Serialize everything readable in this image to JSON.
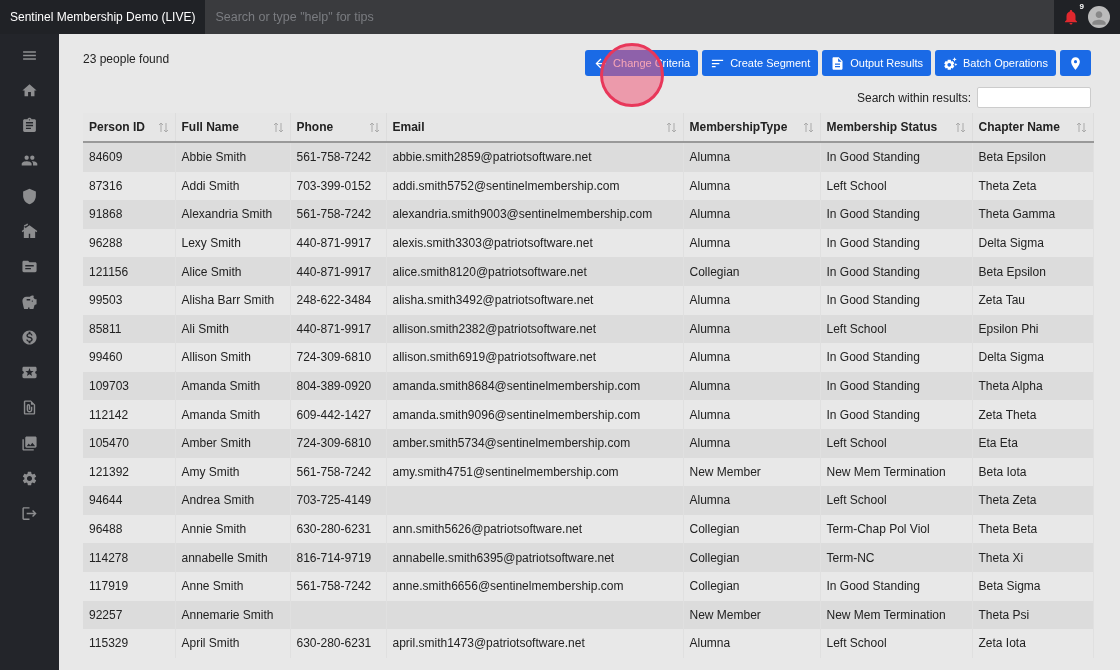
{
  "app": {
    "title": "Sentinel Membership Demo (LIVE)",
    "search": {
      "placeholder": "Search or type \"help\" for tips"
    },
    "notifications": {
      "count": "9"
    }
  },
  "results": {
    "summary": "23 people found",
    "buttons": [
      "Change Criteria",
      "Create Segment",
      "Output Results",
      "Batch Operations"
    ],
    "click_marker": true,
    "search": {
      "label": "Search within results:"
    },
    "table": {
      "columns": [
        "Person ID",
        "Full Name",
        "Phone",
        "Email",
        "MembershipType",
        "Membership Status",
        "Chapter Name"
      ],
      "rows": [
        [
          "84609",
          "Abbie Smith",
          "561-758-7242",
          "abbie.smith2859@patriotsoftware.net",
          "Alumna",
          "In Good Standing",
          "Beta Epsilon"
        ],
        [
          "87316",
          "Addi Smith",
          "703-399-0152",
          "addi.smith5752@sentinelmembership.com",
          "Alumna",
          "Left School",
          "Theta Zeta"
        ],
        [
          "91868",
          "Alexandria Smith",
          "561-758-7242",
          "alexandria.smith9003@sentinelmembership.com",
          "Alumna",
          "In Good Standing",
          "Theta Gamma"
        ],
        [
          "96288",
          "Lexy Smith",
          "440-871-9917",
          "alexis.smith3303@patriotsoftware.net",
          "Alumna",
          "In Good Standing",
          "Delta Sigma"
        ],
        [
          "121156",
          "Alice Smith",
          "440-871-9917",
          "alice.smith8120@patriotsoftware.net",
          "Collegian",
          "In Good Standing",
          "Beta Epsilon"
        ],
        [
          "99503",
          "Alisha Barr Smith",
          "248-622-3484",
          "alisha.smith3492@patriotsoftware.net",
          "Alumna",
          "In Good Standing",
          "Zeta Tau"
        ],
        [
          "85811",
          "Ali Smith",
          "440-871-9917",
          "allison.smith2382@patriotsoftware.net",
          "Alumna",
          "Left School",
          "Epsilon Phi"
        ],
        [
          "99460",
          "Allison Smith",
          "724-309-6810",
          "allison.smith6919@patriotsoftware.net",
          "Alumna",
          "In Good Standing",
          "Delta Sigma"
        ],
        [
          "109703",
          "Amanda Smith",
          "804-389-0920",
          "amanda.smith8684@sentinelmembership.com",
          "Alumna",
          "In Good Standing",
          "Theta Alpha"
        ],
        [
          "112142",
          "Amanda Smith",
          "609-442-1427",
          "amanda.smith9096@sentinelmembership.com",
          "Alumna",
          "In Good Standing",
          "Zeta Theta"
        ],
        [
          "105470",
          "Amber Smith",
          "724-309-6810",
          "amber.smith5734@sentinelmembership.com",
          "Alumna",
          "Left School",
          "Eta Eta"
        ],
        [
          "121392",
          "Amy Smith",
          "561-758-7242",
          "amy.smith4751@sentinelmembership.com",
          "New Member",
          "New Mem Termination",
          "Beta Iota"
        ],
        [
          "94644",
          "Andrea Smith",
          "703-725-4149",
          "",
          "Alumna",
          "Left School",
          "Theta Zeta"
        ],
        [
          "96488",
          "Annie Smith",
          "630-280-6231",
          "ann.smith5626@patriotsoftware.net",
          "Collegian",
          "Term-Chap Pol Viol",
          "Theta Beta"
        ],
        [
          "114278",
          "annabelle Smith",
          "816-714-9719",
          "annabelle.smith6395@patriotsoftware.net",
          "Collegian",
          "Term-NC",
          "Theta Xi"
        ],
        [
          "117919",
          "Anne Smith",
          "561-758-7242",
          "anne.smith6656@sentinelmembership.com",
          "Collegian",
          "In Good Standing",
          "Beta Sigma"
        ],
        [
          "92257",
          "Annemarie Smith",
          "",
          "",
          "New Member",
          "New Mem Termination",
          "Theta Psi"
        ],
        [
          "115329",
          "April Smith",
          "630-280-6231",
          "april.smith1473@patriotsoftware.net",
          "Alumna",
          "Left School",
          "Zeta Iota"
        ]
      ]
    }
  }
}
